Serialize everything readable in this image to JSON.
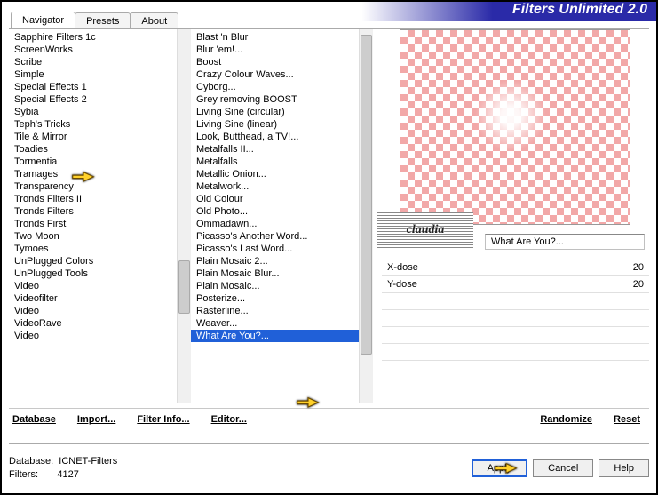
{
  "header": {
    "title": "Filters Unlimited 2.0"
  },
  "tabs": [
    {
      "label": "Navigator",
      "active": true
    },
    {
      "label": "Presets",
      "active": false
    },
    {
      "label": "About",
      "active": false
    }
  ],
  "list1": [
    "Sapphire Filters 1c",
    "ScreenWorks",
    "Scribe",
    "Simple",
    "Special Effects 1",
    "Special Effects 2",
    "Sybia",
    "Teph's Tricks",
    "Tile & Mirror",
    "Toadies",
    "Tormentia",
    "Tramages",
    "Transparency",
    "Tronds Filters II",
    "Tronds Filters",
    "Tronds First",
    "Two Moon",
    "Tymoes",
    "UnPlugged Colors",
    "UnPlugged Tools",
    "Video",
    "Videofilter",
    "Video",
    "VideoRave",
    "Video"
  ],
  "list1_hl_index": 9,
  "list2": [
    "Blast 'n Blur",
    "Blur 'em!...",
    "Boost",
    "Crazy Colour Waves...",
    "Cyborg...",
    "Grey removing BOOST",
    "Living Sine (circular)",
    "Living Sine (linear)",
    "Look, Butthead, a TV!...",
    "Metalfalls II...",
    "Metalfalls",
    "Metallic Onion...",
    "Metalwork...",
    "Old Colour",
    "Old Photo...",
    "Ommadawn...",
    "Picasso's Another Word...",
    "Picasso's Last Word...",
    "Plain Mosaic 2...",
    "Plain Mosaic Blur...",
    "Plain Mosaic...",
    "Posterize...",
    "Rasterline...",
    "Weaver...",
    "What Are You?..."
  ],
  "list2_sel_index": 24,
  "filter_name": "What Are You?...",
  "params": [
    {
      "name": "X-dose",
      "value": 20
    },
    {
      "name": "Y-dose",
      "value": 20
    }
  ],
  "bottom_links": {
    "database": "Database",
    "import": "Import...",
    "filterinfo": "Filter Info...",
    "editor": "Editor...",
    "randomize": "Randomize",
    "reset": "Reset"
  },
  "footer": {
    "db_label": "Database:",
    "db_value": "ICNET-Filters",
    "filters_label": "Filters:",
    "filters_value": "4127",
    "apply": "Apply",
    "cancel": "Cancel",
    "help": "Help"
  },
  "watermark": "claudia"
}
